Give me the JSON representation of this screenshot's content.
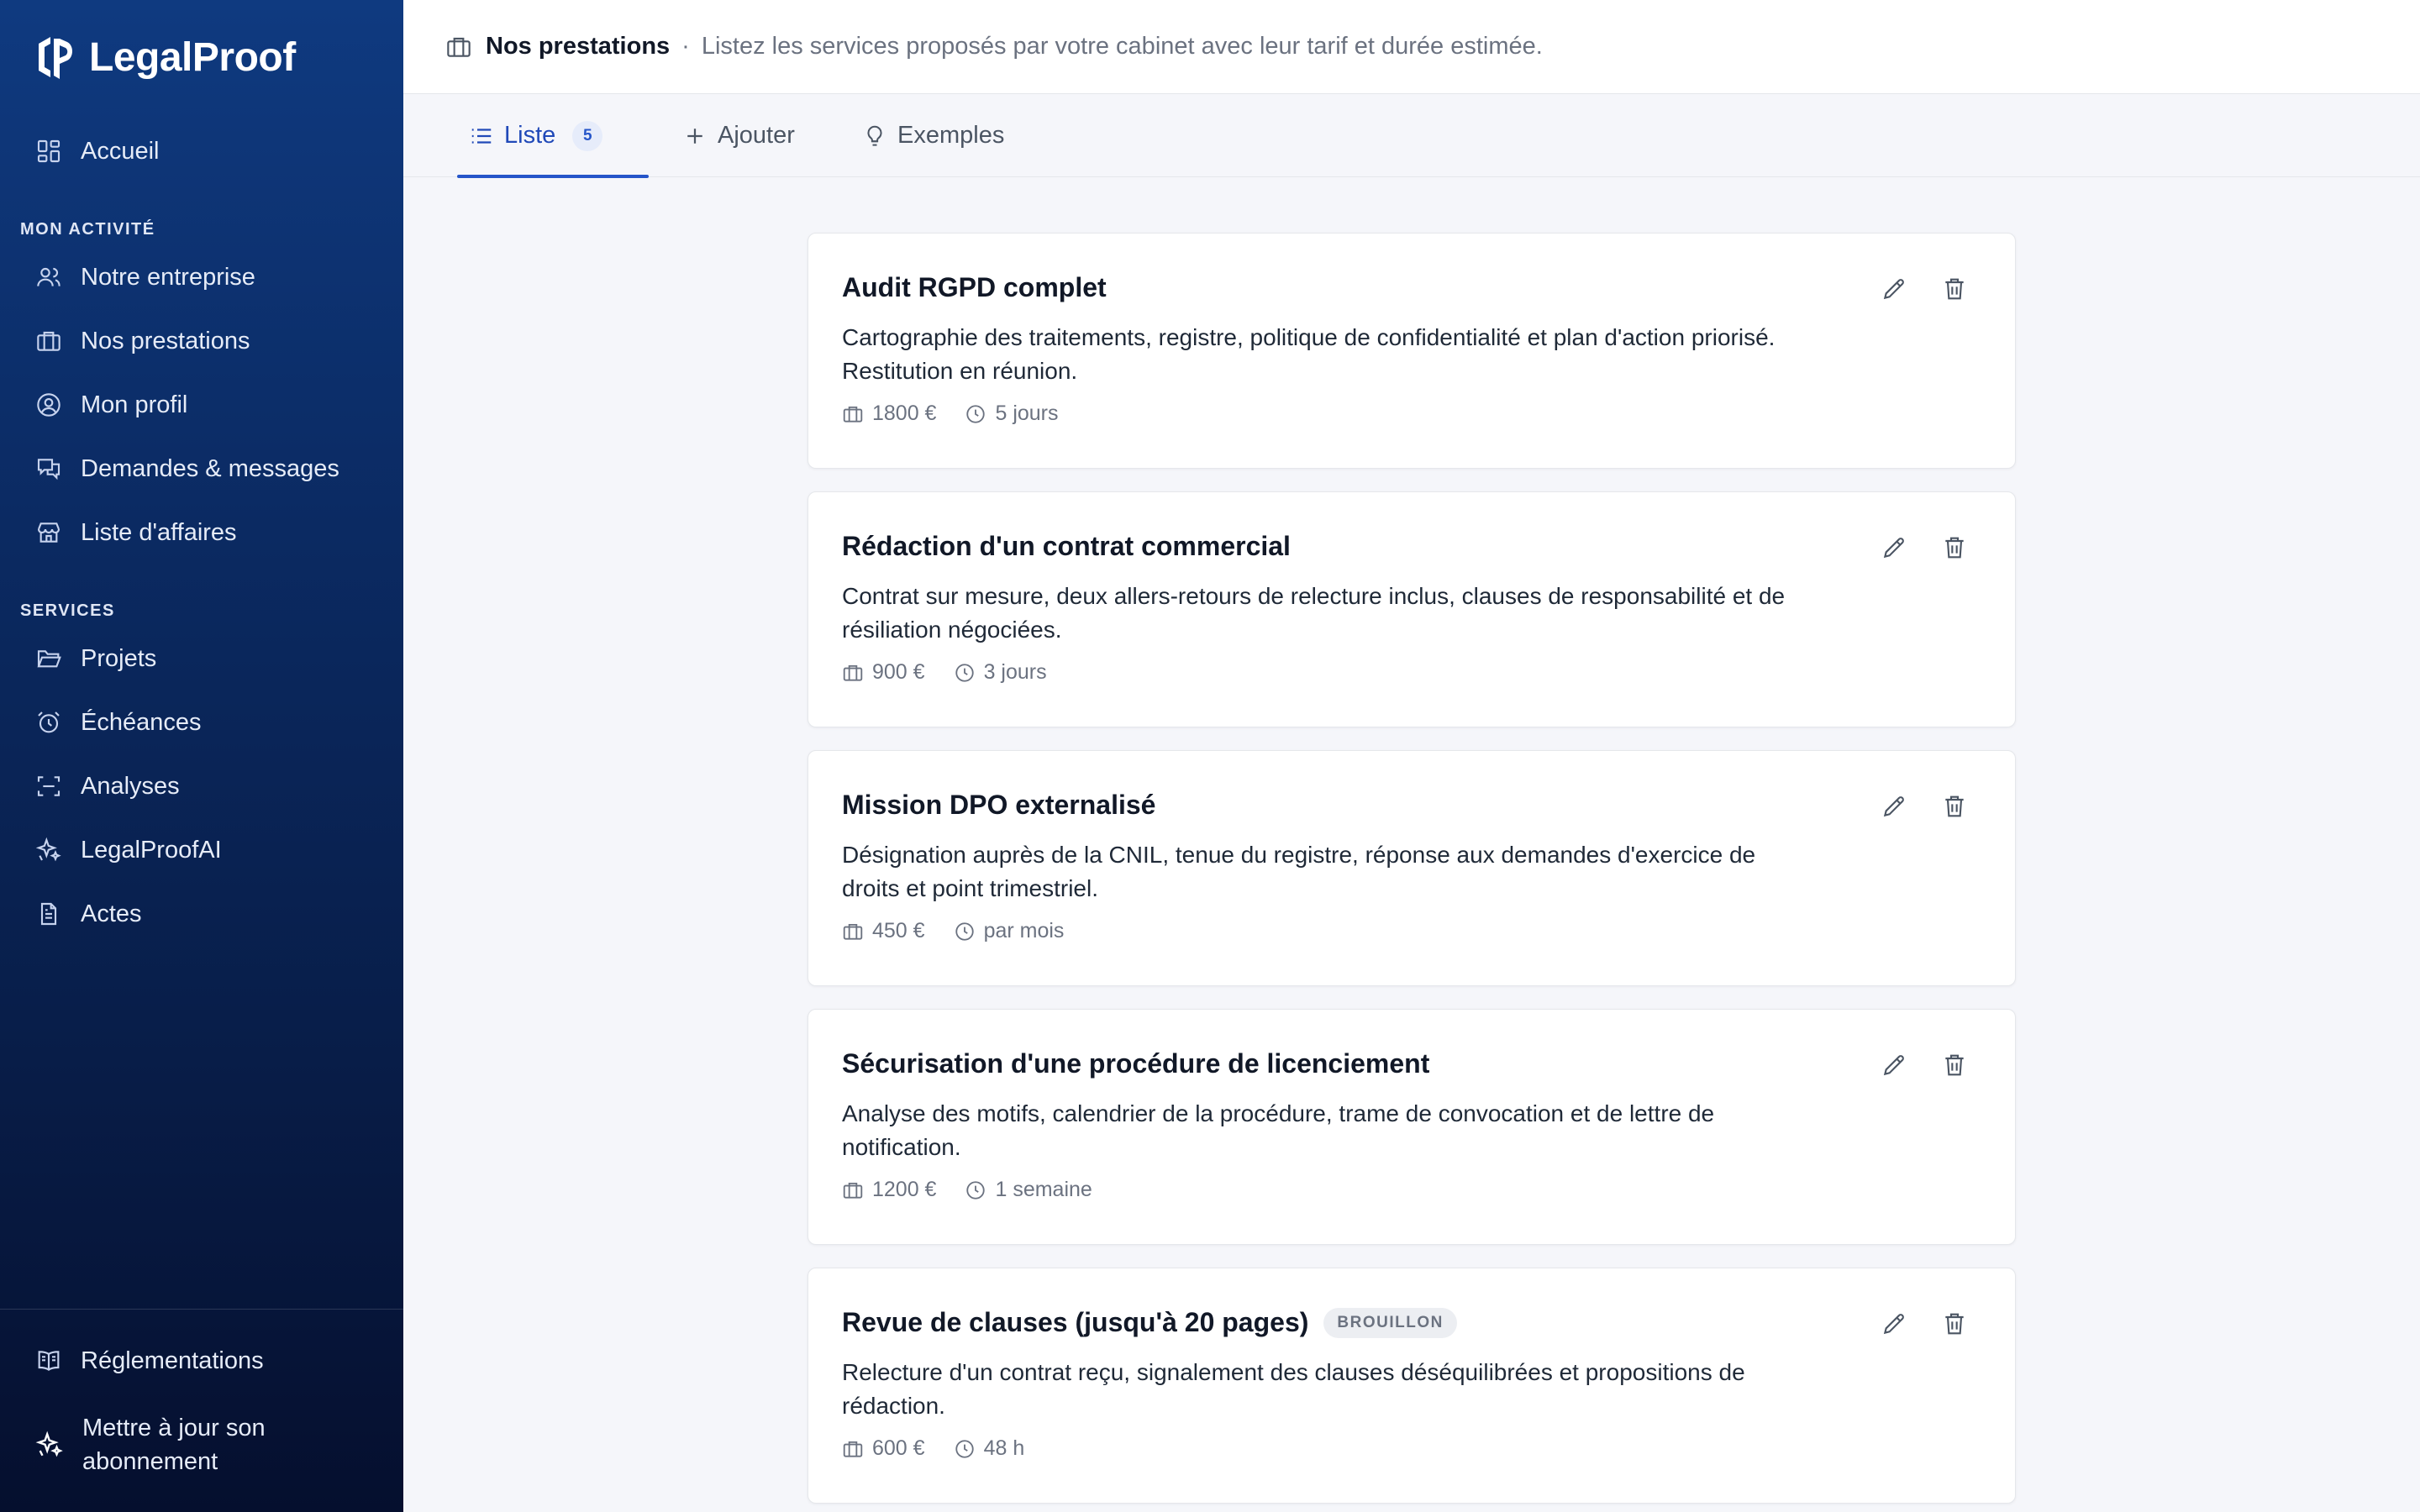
{
  "brand": {
    "name": "LegalProof"
  },
  "sidebar": {
    "home": {
      "label": "Accueil",
      "icon": "dashboard-icon"
    },
    "sections": [
      {
        "title": "MON ACTIVITÉ",
        "items": [
          {
            "label": "Notre entreprise",
            "icon": "users-icon"
          },
          {
            "label": "Nos prestations",
            "icon": "briefcase-icon"
          },
          {
            "label": "Mon profil",
            "icon": "user-circle-icon"
          },
          {
            "label": "Demandes & messages",
            "icon": "messages-icon"
          },
          {
            "label": "Liste d'affaires",
            "icon": "store-icon"
          }
        ]
      },
      {
        "title": "SERVICES",
        "items": [
          {
            "label": "Projets",
            "icon": "folder-icon"
          },
          {
            "label": "Échéances",
            "icon": "alarm-icon"
          },
          {
            "label": "Analyses",
            "icon": "scan-icon"
          },
          {
            "label": "LegalProofAI",
            "icon": "sparkles-icon"
          },
          {
            "label": "Actes",
            "icon": "document-icon"
          }
        ]
      }
    ],
    "footer": {
      "regulations": {
        "label": "Réglementations",
        "icon": "book-icon"
      },
      "upgrade": {
        "label": "Mettre à jour son abonnement",
        "icon": "sparkle-icon"
      }
    }
  },
  "header": {
    "title": "Nos prestations",
    "separator": "·",
    "description": "Listez les services proposés par votre cabinet avec leur tarif et durée estimée."
  },
  "tabs": [
    {
      "label": "Liste",
      "count": "5",
      "active": true
    },
    {
      "label": "Ajouter"
    },
    {
      "label": "Exemples"
    }
  ],
  "services": [
    {
      "title": "Audit RGPD complet",
      "description": "Cartographie des traitements, registre, politique de confidentialité et plan d'action priorisé. Restitution en réunion.",
      "price": "1800 €",
      "duration": "5 jours"
    },
    {
      "title": "Rédaction d'un contrat commercial",
      "description": "Contrat sur mesure, deux allers-retours de relecture inclus, clauses de responsabilité et de résiliation négociées.",
      "price": "900 €",
      "duration": "3 jours"
    },
    {
      "title": "Mission DPO externalisé",
      "description": "Désignation auprès de la CNIL, tenue du registre, réponse aux demandes d'exercice de droits et point trimestriel.",
      "price": "450 €",
      "duration": "par mois"
    },
    {
      "title": "Sécurisation d'une procédure de licenciement",
      "description": "Analyse des motifs, calendrier de la procédure, trame de convocation et de lettre de notification.",
      "price": "1200 €",
      "duration": "1 semaine"
    },
    {
      "title": "Revue de clauses (jusqu'à 20 pages)",
      "badge": "BROUILLON",
      "description": "Relecture d'un contrat reçu, signalement des clauses déséquilibrées et propositions de rédaction.",
      "price": "600 €",
      "duration": "48 h"
    }
  ],
  "colors": {
    "sidebar_top": "#0f3a80",
    "sidebar_bottom": "#050f2e",
    "accent": "#2555c9",
    "background": "#f5f6fa"
  }
}
